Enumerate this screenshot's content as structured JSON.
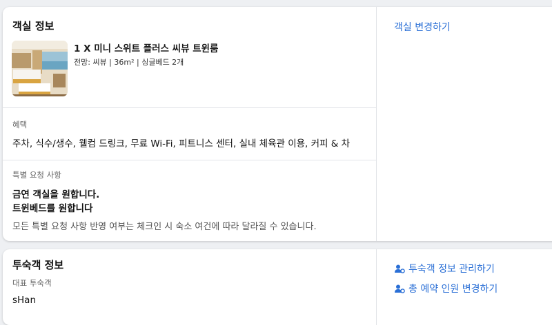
{
  "room": {
    "section_title": "객실 정보",
    "change_link": "객실 변경하기",
    "name": "1 X 미니 스위트 플러스 씨뷰 트윈룸",
    "meta": "전망: 씨뷰 | 36m² | 싱글베드 2개",
    "benefits_label": "혜택",
    "benefits": "주차, 식수/생수, 웰컴 드링크, 무료 Wi-Fi, 피트니스 센터, 실내 체육관 이용, 커피 & 차",
    "requests_label": "특별 요청 사항",
    "requests": [
      "금연 객실을 원합니다.",
      "트윈베드를 원합니다"
    ],
    "requests_note": "모든 특별 요청 사항 반영 여부는 체크인 시 숙소 여건에 따라 달라질 수 있습니다."
  },
  "guest": {
    "section_title": "투숙객 정보",
    "lead_label": "대표 투숙객",
    "lead_name": "sHan",
    "manage_link": "투숙객 정보 관리하기",
    "change_count_link": "총 예약 인원 변경하기"
  },
  "colors": {
    "link": "#2a6fd6",
    "background": "#eef0f3"
  }
}
